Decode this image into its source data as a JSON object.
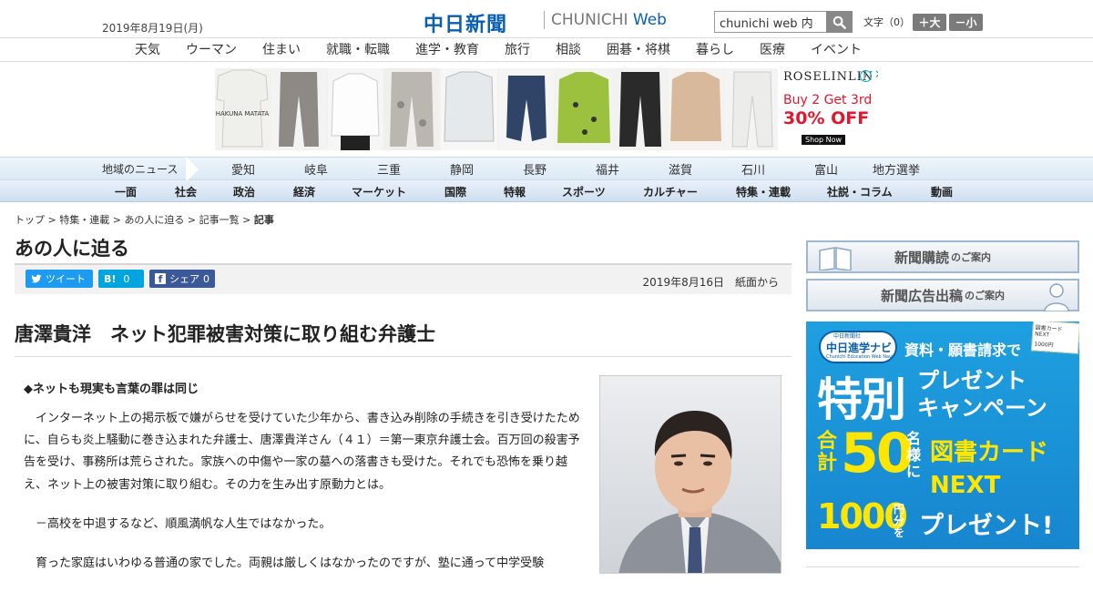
{
  "header": {
    "date": "2019年8月19日(月)",
    "logo_jp": "中日新聞",
    "logo_en": "CHUNICHI",
    "logo_web": "Web",
    "search_value": "chunichi web 内",
    "fontsize_label": "文字（0）",
    "font_plus": "＋大",
    "font_minus": "－小"
  },
  "subnav": [
    "天気",
    "ウーマン",
    "住まい",
    "就職・転職",
    "進学・教育",
    "旅行",
    "相談",
    "囲碁・将棋",
    "暮らし",
    "医療",
    "イベント"
  ],
  "ad": {
    "brand": "ROSELINLIN",
    "line1": "Buy 2 Get 3rd",
    "line2": "30% OFF",
    "cta": "Shop Now",
    "shirt_text": "HAKUNA MATATA"
  },
  "region": {
    "label": "地域のニュース",
    "items": [
      "愛知",
      "岐阜",
      "三重",
      "静岡",
      "長野",
      "福井",
      "滋賀",
      "石川",
      "富山",
      "地方選挙"
    ]
  },
  "categories": [
    "一面",
    "社会",
    "政治",
    "経済",
    "マーケット",
    "国際",
    "特報",
    "スポーツ",
    "カルチャー",
    "特集・連載",
    "社説・コラム",
    "動画"
  ],
  "breadcrumb": {
    "items": [
      "トップ",
      "特集・連載",
      "あの人に迫る",
      "記事一覧"
    ],
    "sep": " > ",
    "current": "記事"
  },
  "section_title": "あの人に迫る",
  "share": {
    "tweet": "ツイート",
    "hatena_count": "0",
    "facebook": "シェア",
    "facebook_count": "0",
    "date": "2019年8月16日　紙面から"
  },
  "article": {
    "headline": "唐澤貴洋　ネット犯罪被害対策に取り組む弁護士",
    "subhead": "◆ネットも現実も言葉の罪は同じ",
    "paragraphs": [
      "　インターネット上の掲示板で嫌がらせを受けていた少年から、書き込み削除の手続きを引き受けたために、自らも炎上騒動に巻き込まれた弁護士、唐澤貴洋さん（４１）＝第一東京弁護士会。百万回の殺害予告を受け、事務所は荒らされた。家族への中傷や一家の墓への落書きも受けた。それでも恐怖を乗り越え、ネット上の被害対策に取り組む。その力を生み出す原動力とは。",
      "　－高校を中退するなど、順風満帆な人生ではなかった。",
      "　育った家庭はいわゆる普通の家でした。両親は厳しくはなかったのですが、塾に通って中学受験"
    ]
  },
  "sidebar": {
    "subscribe": "新聞購読",
    "subscribe_small": "のご案内",
    "adpost": "新聞広告出稿",
    "adpost_small": "のご案内",
    "ad": {
      "badge": "中日進学ナビ",
      "badge_top": "中日新聞社",
      "badge_small": "Chunichi Education Web Navi",
      "top_text": "資料・願書請求で",
      "card_text": "図書カード NEXT",
      "card_amount": "1000円",
      "big1": "特別",
      "big2a": "プレゼント",
      "big2b": "キャンペーン",
      "gokei": "合計",
      "fifty": "50",
      "meisama": "名様に",
      "next": "図書カードNEXT",
      "amount": "1000",
      "yen": "円分を",
      "present": "プレゼント!"
    }
  },
  "colors": {
    "brand": "#0a5fb0",
    "twitter": "#1d9bf0",
    "hatena": "#00a4de",
    "facebook": "#3b5998",
    "navi_ad": "#1a8fd6",
    "ad_red": "#e0182d"
  }
}
